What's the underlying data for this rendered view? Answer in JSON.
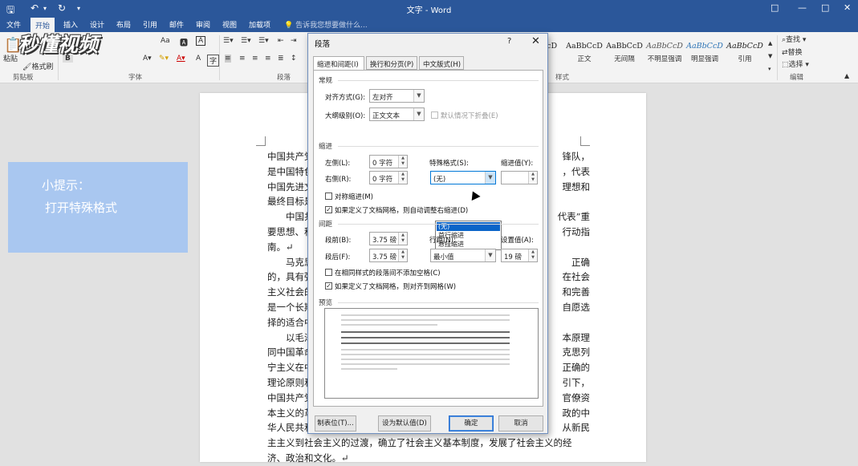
{
  "window": {
    "title": "文字 - Word",
    "qat": {
      "save_icon": "save-icon",
      "undo_icon": "undo-icon",
      "redo_icon": "redo-icon"
    },
    "controls": {
      "ribbon_display": "□",
      "minimize": "—",
      "maximize": "□",
      "close": "✕"
    }
  },
  "tabs": [
    "文件",
    "开始",
    "插入",
    "设计",
    "布局",
    "引用",
    "邮件",
    "审阅",
    "视图",
    "加载项"
  ],
  "active_tab": "开始",
  "tell_me": "告诉我您想要做什么...",
  "ribbon": {
    "clipboard": {
      "paste": "粘贴",
      "format_painter": "格式刷",
      "group_label": "剪贴板"
    },
    "font": {
      "group_label": "字体",
      "font_size_btn": "Aa",
      "bold": "B",
      "italic": "I",
      "phonetic": "A"
    },
    "paragraph": {
      "group_label": "段落"
    },
    "styles": {
      "group_label": "样式",
      "items": [
        {
          "sample": "AaBbCcD",
          "name": "正文"
        },
        {
          "sample": "AaBbCcD",
          "name": "无间隔"
        },
        {
          "sample": "AaBbCcD",
          "name": "不明显强调"
        },
        {
          "sample": "AaBbCcD",
          "name": "明显强调"
        },
        {
          "sample": "AaBbCcD",
          "name": "引用"
        }
      ],
      "partial_sample": "CcD"
    },
    "editing": {
      "find": "查找",
      "replace": "替换",
      "select": "选择",
      "group_label": "编辑"
    }
  },
  "tip": {
    "line1": "小提示：",
    "line2": "打开特殊格式"
  },
  "watermark": "秒懂视频",
  "document": {
    "lines": [
      "中国共产党是中国工人阶级的先",
      "是中国特色社会主义事业的领",
      "中国先进文化的前进方向，代",
      "最终目标是实现共产主义的社",
      "　　中国共产党以马克思列宁",
      "要思想、科学发展观、习近平",
      "南。↵",
      "　　马克思列宁主义揭示了人",
      "的，具有强大的生命力。共产",
      "主义社会的发展和完善是一个",
      "是一个长期的历史过程。共产",
      "择的适合中国国情的道路。↵",
      "　　以毛泽东为主要代表的中",
      "同中国革命的具体实践结合起",
      "宁主义在中国的运用和发展，",
      "理论原则和经验总结，是中国",
      "中国共产党领导全国各族人民",
      "本主义的革命，建立了以工人",
      "华人民共和国，确立了社会主",
      "主主义到社会主义的过渡，确立了社会主义基本制度，发展了社会主义的经",
      "济、政治和文化。↵"
    ],
    "right_fragments": [
      "锋队，",
      "，代表",
      "理想和",
      "",
      "代表”重",
      "行动指",
      "",
      "正确",
      "在社会",
      "和完善",
      "自愿选",
      "",
      "本原理",
      "克思列",
      "正确的",
      "引下，",
      "官僚资",
      "政的中",
      "从新民",
      "",
      ""
    ]
  },
  "dialog": {
    "title": "段落",
    "help": "?",
    "close": "✕",
    "tabs": [
      "缩进和间距(I)",
      "换行和分页(P)",
      "中文版式(H)"
    ],
    "general": {
      "section": "常规",
      "alignment_label": "对齐方式(G):",
      "alignment_value": "左对齐",
      "outline_label": "大纲级别(O):",
      "outline_value": "正文文本",
      "collapsed_label": "默认情况下折叠(E)"
    },
    "indent": {
      "section": "缩进",
      "left_label": "左侧(L):",
      "left_value": "0 字符",
      "right_label": "右侧(R):",
      "right_value": "0 字符",
      "special_label": "特殊格式(S):",
      "special_value": "(无)",
      "by_label": "缩进值(Y):",
      "by_value": "",
      "mirror_label": "对称缩进(M)",
      "grid_label": "如果定义了文档网格，则自动调整右缩进(D)",
      "special_options": [
        "(无)",
        "首行缩进",
        "悬挂缩进"
      ]
    },
    "spacing": {
      "section": "间距",
      "before_label": "段前(B):",
      "before_value": "3.75 磅",
      "after_label": "段后(F):",
      "after_value": "3.75 磅",
      "line_label": "行距(N):",
      "line_value": "最小值",
      "at_label": "设置值(A):",
      "at_value": "19 磅",
      "no_space_label": "在相同样式的段落间不添加空格(C)",
      "snap_label": "如果定义了文档网格，则对齐到网格(W)"
    },
    "preview": {
      "section": "预览"
    },
    "buttons": {
      "tabs": "制表位(T)...",
      "default": "设为默认值(D)",
      "ok": "确定",
      "cancel": "取消"
    }
  }
}
